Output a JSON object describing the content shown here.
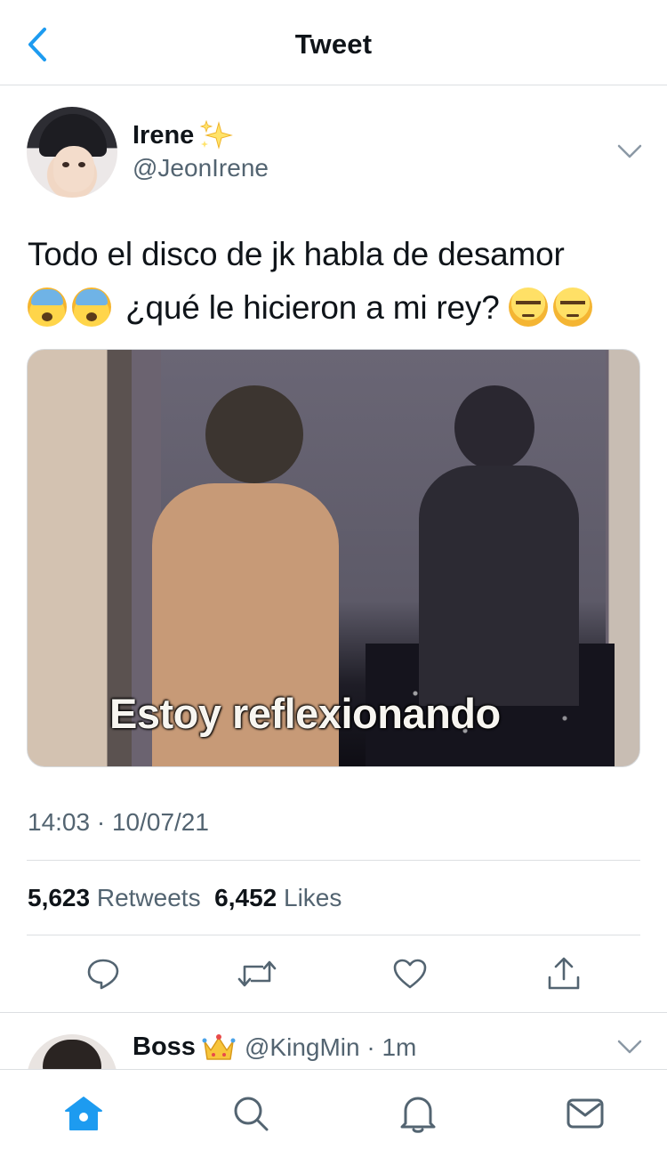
{
  "header": {
    "title": "Tweet",
    "back_icon": "chevron-left-icon"
  },
  "tweet": {
    "author_name": "Irene",
    "author_handle": "@JeonIrene",
    "text_line1": "Todo el disco de jk habla de desamor",
    "text_line2": "¿qué le hicieron a mi rey?",
    "media_caption": "Estoy reflexionando",
    "timestamp": "14:03 · 10/07/21",
    "retweets_count": "5,623",
    "retweets_label": "Retweets",
    "likes_count": "6,452",
    "likes_label": "Likes"
  },
  "actions": [
    "reply-icon",
    "retweet-icon",
    "like-icon",
    "share-icon"
  ],
  "reply": {
    "author_name": "Boss",
    "author_handle": "@KingMin",
    "time": "· 1m"
  },
  "tabbar": [
    "home-icon",
    "search-icon",
    "notifications-icon",
    "messages-icon"
  ],
  "colors": {
    "accent": "#1d9bf0",
    "secondary_text": "#536471",
    "divider": "#dcdfe2"
  }
}
